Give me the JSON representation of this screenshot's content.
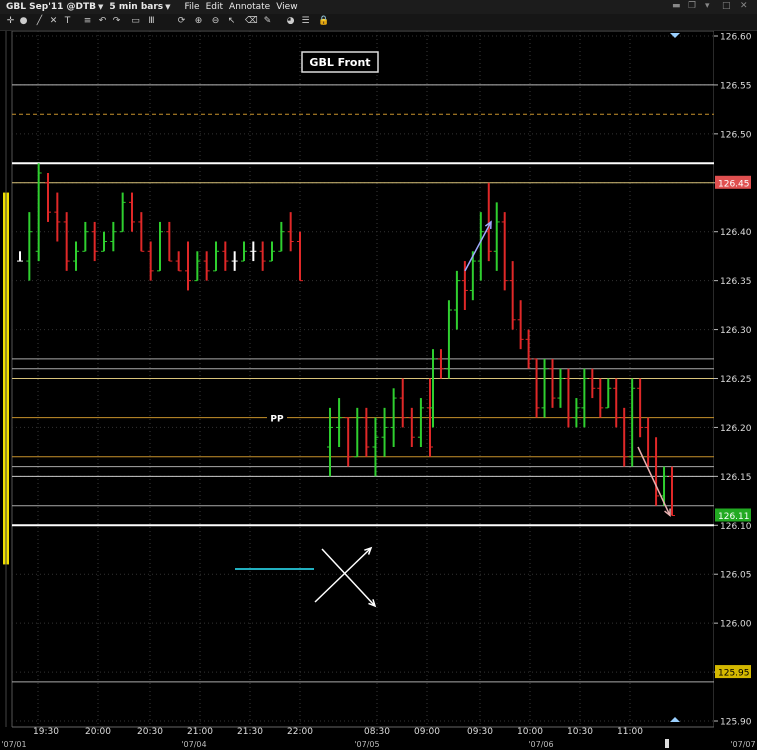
{
  "menu": {
    "symbol": "GBL Sep'11 @DTB",
    "timeframe": "5 min bars",
    "items": [
      "File",
      "Edit",
      "Annotate",
      "View"
    ]
  },
  "toolbar_icons": [
    "crosshair-icon",
    "circle-icon",
    "line-icon",
    "cross-icon",
    "text-icon",
    "fibonacci-icon",
    "undo-icon",
    "redo-icon",
    "rectangle-icon",
    "bar-style-icon",
    "refresh-icon",
    "zoom-in-icon",
    "zoom-out-icon",
    "pointer-icon",
    "eraser-icon",
    "wrench-icon",
    "palette-icon",
    "list-icon",
    "lock-icon"
  ],
  "chart_data": {
    "type": "bar",
    "title": "GBL Front",
    "ylim": [
      125.9,
      126.6
    ],
    "y_ticks": [
      "126.60",
      "126.55",
      "126.50",
      "126.45",
      "126.40",
      "126.35",
      "126.30",
      "126.25",
      "126.20",
      "126.15",
      "126.10",
      "126.05",
      "126.00",
      "125.95",
      "125.90"
    ],
    "x_ticks": [
      "19:30",
      "20:00",
      "20:30",
      "21:00",
      "21:30",
      "22:00",
      "08:30",
      "09:00",
      "09:30",
      "10:00",
      "10:30",
      "11:00"
    ],
    "date_ticks": [
      "'07/01",
      "'07/04",
      "'07/05",
      "'07/06",
      "'07/07"
    ],
    "price_markers": [
      {
        "label": "126.45",
        "value": 126.45,
        "color": "#e05050"
      },
      {
        "label": "126.11",
        "value": 126.11,
        "color": "#22aa22"
      },
      {
        "label": "125.95",
        "value": 125.95,
        "color": "#d4b800"
      }
    ],
    "pivot_label": "PP",
    "pivot_value": 126.21,
    "levels": [
      {
        "value": 126.55,
        "color": "#bbbbbb"
      },
      {
        "value": 126.52,
        "color": "#c8922c",
        "dashed": true
      },
      {
        "value": 126.47,
        "color": "#ffffff",
        "thick": true
      },
      {
        "value": 126.45,
        "color": "#d9c37a"
      },
      {
        "value": 126.27,
        "color": "#aaaaaa"
      },
      {
        "value": 126.26,
        "color": "#aaaaaa"
      },
      {
        "value": 126.25,
        "color": "#d9c37a"
      },
      {
        "value": 126.21,
        "color": "#c8922c"
      },
      {
        "value": 126.17,
        "color": "#c8922c"
      },
      {
        "value": 126.16,
        "color": "#aaaaaa"
      },
      {
        "value": 126.15,
        "color": "#cccccc"
      },
      {
        "value": 126.12,
        "color": "#aaaaaa"
      },
      {
        "value": 126.1,
        "color": "#ffffff",
        "thick": true
      },
      {
        "value": 125.94,
        "color": "#aaaaaa"
      }
    ],
    "segments": [
      {
        "x0": 20,
        "x1": 300,
        "open": 126.36,
        "bars": [
          [
            126.37,
            126.38,
            126.37,
            126.37
          ],
          [
            126.37,
            126.42,
            126.35,
            126.4
          ],
          [
            126.38,
            126.47,
            126.37,
            126.46
          ],
          [
            126.45,
            126.46,
            126.41,
            126.42
          ],
          [
            126.42,
            126.44,
            126.39,
            126.41
          ],
          [
            126.41,
            126.42,
            126.36,
            126.37
          ],
          [
            126.37,
            126.39,
            126.36,
            126.38
          ],
          [
            126.38,
            126.41,
            126.38,
            126.4
          ],
          [
            126.4,
            126.41,
            126.37,
            126.38
          ],
          [
            126.38,
            126.4,
            126.38,
            126.39
          ],
          [
            126.39,
            126.41,
            126.38,
            126.4
          ],
          [
            126.4,
            126.44,
            126.4,
            126.43
          ],
          [
            126.43,
            126.44,
            126.4,
            126.41
          ],
          [
            126.41,
            126.42,
            126.38,
            126.38
          ],
          [
            126.38,
            126.39,
            126.35,
            126.36
          ],
          [
            126.36,
            126.41,
            126.36,
            126.4
          ],
          [
            126.4,
            126.41,
            126.37,
            126.37
          ],
          [
            126.37,
            126.38,
            126.36,
            126.36
          ],
          [
            126.36,
            126.39,
            126.34,
            126.35
          ],
          [
            126.35,
            126.38,
            126.35,
            126.37
          ],
          [
            126.37,
            126.38,
            126.35,
            126.36
          ],
          [
            126.36,
            126.39,
            126.36,
            126.38
          ],
          [
            126.38,
            126.39,
            126.36,
            126.37
          ],
          [
            126.37,
            126.38,
            126.36,
            126.37
          ],
          [
            126.37,
            126.39,
            126.37,
            126.38
          ],
          [
            126.38,
            126.39,
            126.37,
            126.38
          ],
          [
            126.38,
            126.39,
            126.36,
            126.37
          ],
          [
            126.37,
            126.39,
            126.37,
            126.38
          ],
          [
            126.38,
            126.41,
            126.38,
            126.4
          ],
          [
            126.4,
            126.42,
            126.38,
            126.39
          ],
          [
            126.39,
            126.4,
            126.35,
            126.35
          ]
        ]
      },
      {
        "x0": 330,
        "x1": 430,
        "bars": [
          [
            126.18,
            126.22,
            126.15,
            126.2
          ],
          [
            126.2,
            126.23,
            126.18,
            126.21
          ],
          [
            126.21,
            126.21,
            126.16,
            126.17
          ],
          [
            126.17,
            126.22,
            126.17,
            126.21
          ],
          [
            126.21,
            126.22,
            126.17,
            126.18
          ],
          [
            126.18,
            126.21,
            126.15,
            126.19
          ],
          [
            126.19,
            126.22,
            126.17,
            126.2
          ],
          [
            126.2,
            126.24,
            126.18,
            126.23
          ],
          [
            126.23,
            126.25,
            126.2,
            126.21
          ],
          [
            126.21,
            126.22,
            126.18,
            126.19
          ],
          [
            126.19,
            126.23,
            126.18,
            126.22
          ],
          [
            126.22,
            126.25,
            126.17,
            126.18
          ]
        ]
      },
      {
        "x0": 433,
        "x1": 672,
        "bars": [
          [
            126.22,
            126.28,
            126.2,
            126.27
          ],
          [
            126.27,
            126.28,
            126.25,
            126.26
          ],
          [
            126.26,
            126.33,
            126.25,
            126.32
          ],
          [
            126.32,
            126.36,
            126.3,
            126.35
          ],
          [
            126.35,
            126.37,
            126.32,
            126.34
          ],
          [
            126.34,
            126.38,
            126.33,
            126.37
          ],
          [
            126.37,
            126.42,
            126.35,
            126.4
          ],
          [
            126.4,
            126.45,
            126.37,
            126.38
          ],
          [
            126.38,
            126.43,
            126.36,
            126.41
          ],
          [
            126.41,
            126.42,
            126.34,
            126.35
          ],
          [
            126.35,
            126.37,
            126.3,
            126.31
          ],
          [
            126.31,
            126.33,
            126.28,
            126.29
          ],
          [
            126.29,
            126.3,
            126.26,
            126.27
          ],
          [
            126.27,
            126.27,
            126.21,
            126.22
          ],
          [
            126.22,
            126.27,
            126.21,
            126.26
          ],
          [
            126.26,
            126.27,
            126.22,
            126.23
          ],
          [
            126.23,
            126.26,
            126.22,
            126.25
          ],
          [
            126.25,
            126.26,
            126.2,
            126.21
          ],
          [
            126.21,
            126.23,
            126.2,
            126.22
          ],
          [
            126.22,
            126.26,
            126.2,
            126.25
          ],
          [
            126.25,
            126.26,
            126.23,
            126.24
          ],
          [
            126.24,
            126.25,
            126.21,
            126.22
          ],
          [
            126.22,
            126.25,
            126.22,
            126.24
          ],
          [
            126.24,
            126.25,
            126.2,
            126.21
          ],
          [
            126.21,
            126.22,
            126.16,
            126.17
          ],
          [
            126.17,
            126.25,
            126.16,
            126.24
          ],
          [
            126.24,
            126.25,
            126.19,
            126.2
          ],
          [
            126.2,
            126.21,
            126.16,
            126.17
          ],
          [
            126.17,
            126.19,
            126.12,
            126.13
          ],
          [
            126.13,
            126.16,
            126.12,
            126.15
          ],
          [
            126.15,
            126.16,
            126.11,
            126.11
          ]
        ]
      }
    ]
  }
}
